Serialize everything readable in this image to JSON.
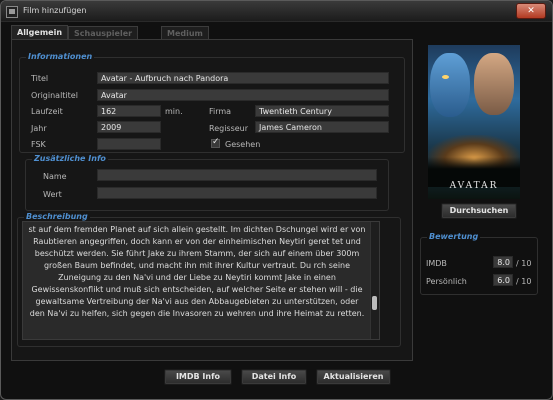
{
  "window": {
    "title": "Film hinzufügen",
    "close_glyph": "✕"
  },
  "tabs": [
    "Allgemein",
    "Schauspieler & Genre",
    "Medium"
  ],
  "info": {
    "legend": "Informationen",
    "titel_label": "Titel",
    "titel_value": "Avatar - Aufbruch nach Pandora",
    "originaltitel_label": "Originaltitel",
    "originaltitel_value": "Avatar",
    "laufzeit_label": "Laufzeit",
    "laufzeit_value": "162",
    "laufzeit_unit": "min.",
    "firma_label": "Firma",
    "firma_value": "Twentieth Century",
    "jahr_label": "Jahr",
    "jahr_value": "2009",
    "regisseur_label": "Regisseur",
    "regisseur_value": "James Cameron",
    "fsk_label": "FSK",
    "fsk_value": "",
    "gesehen_label": "Gesehen",
    "gesehen_checked": true
  },
  "extra": {
    "legend": "Zusätzliche Info",
    "name_label": "Name",
    "name_value": "",
    "wert_label": "Wert",
    "wert_value": ""
  },
  "beschreibung": {
    "legend": "Beschreibung",
    "text": "st auf dem fremden Planet auf sich allein gestellt. Im dichten Dschungel wird er von Raubtieren angegriffen, doch kann er von der einheimischen Neytiri geret tet und beschützt werden. Sie führt Jake zu ihrem Stamm, der sich auf einem über 300m großen Baum befindet, und macht ihn mit ihrer Kultur vertraut. Du rch seine Zuneigung zu den Na'vi und der Liebe zu Neytiri kommt Jake in einen Gewissenskonflikt und muß sich entscheiden, auf welcher Seite er stehen will - die gewaltsame Vertreibung der Na'vi aus den Abbaugebieten zu unterstützen, oder den Na'vi zu helfen, sich gegen die Invasoren zu wehren und ihre Heimat zu retten."
  },
  "poster": {
    "title": "AVATAR"
  },
  "durchsuchen_label": "Durchsuchen",
  "bewertung": {
    "legend": "Bewertung",
    "imdb_label": "IMDB",
    "imdb_value": "8.0",
    "imdb_max": "/ 10",
    "persoenlich_label": "Persönlich",
    "persoenlich_value": "6.0",
    "persoenlich_max": "/ 10"
  },
  "buttons": {
    "imdb": "IMDB Info",
    "datei": "Datei Info",
    "aktualisieren": "Aktualisieren"
  }
}
